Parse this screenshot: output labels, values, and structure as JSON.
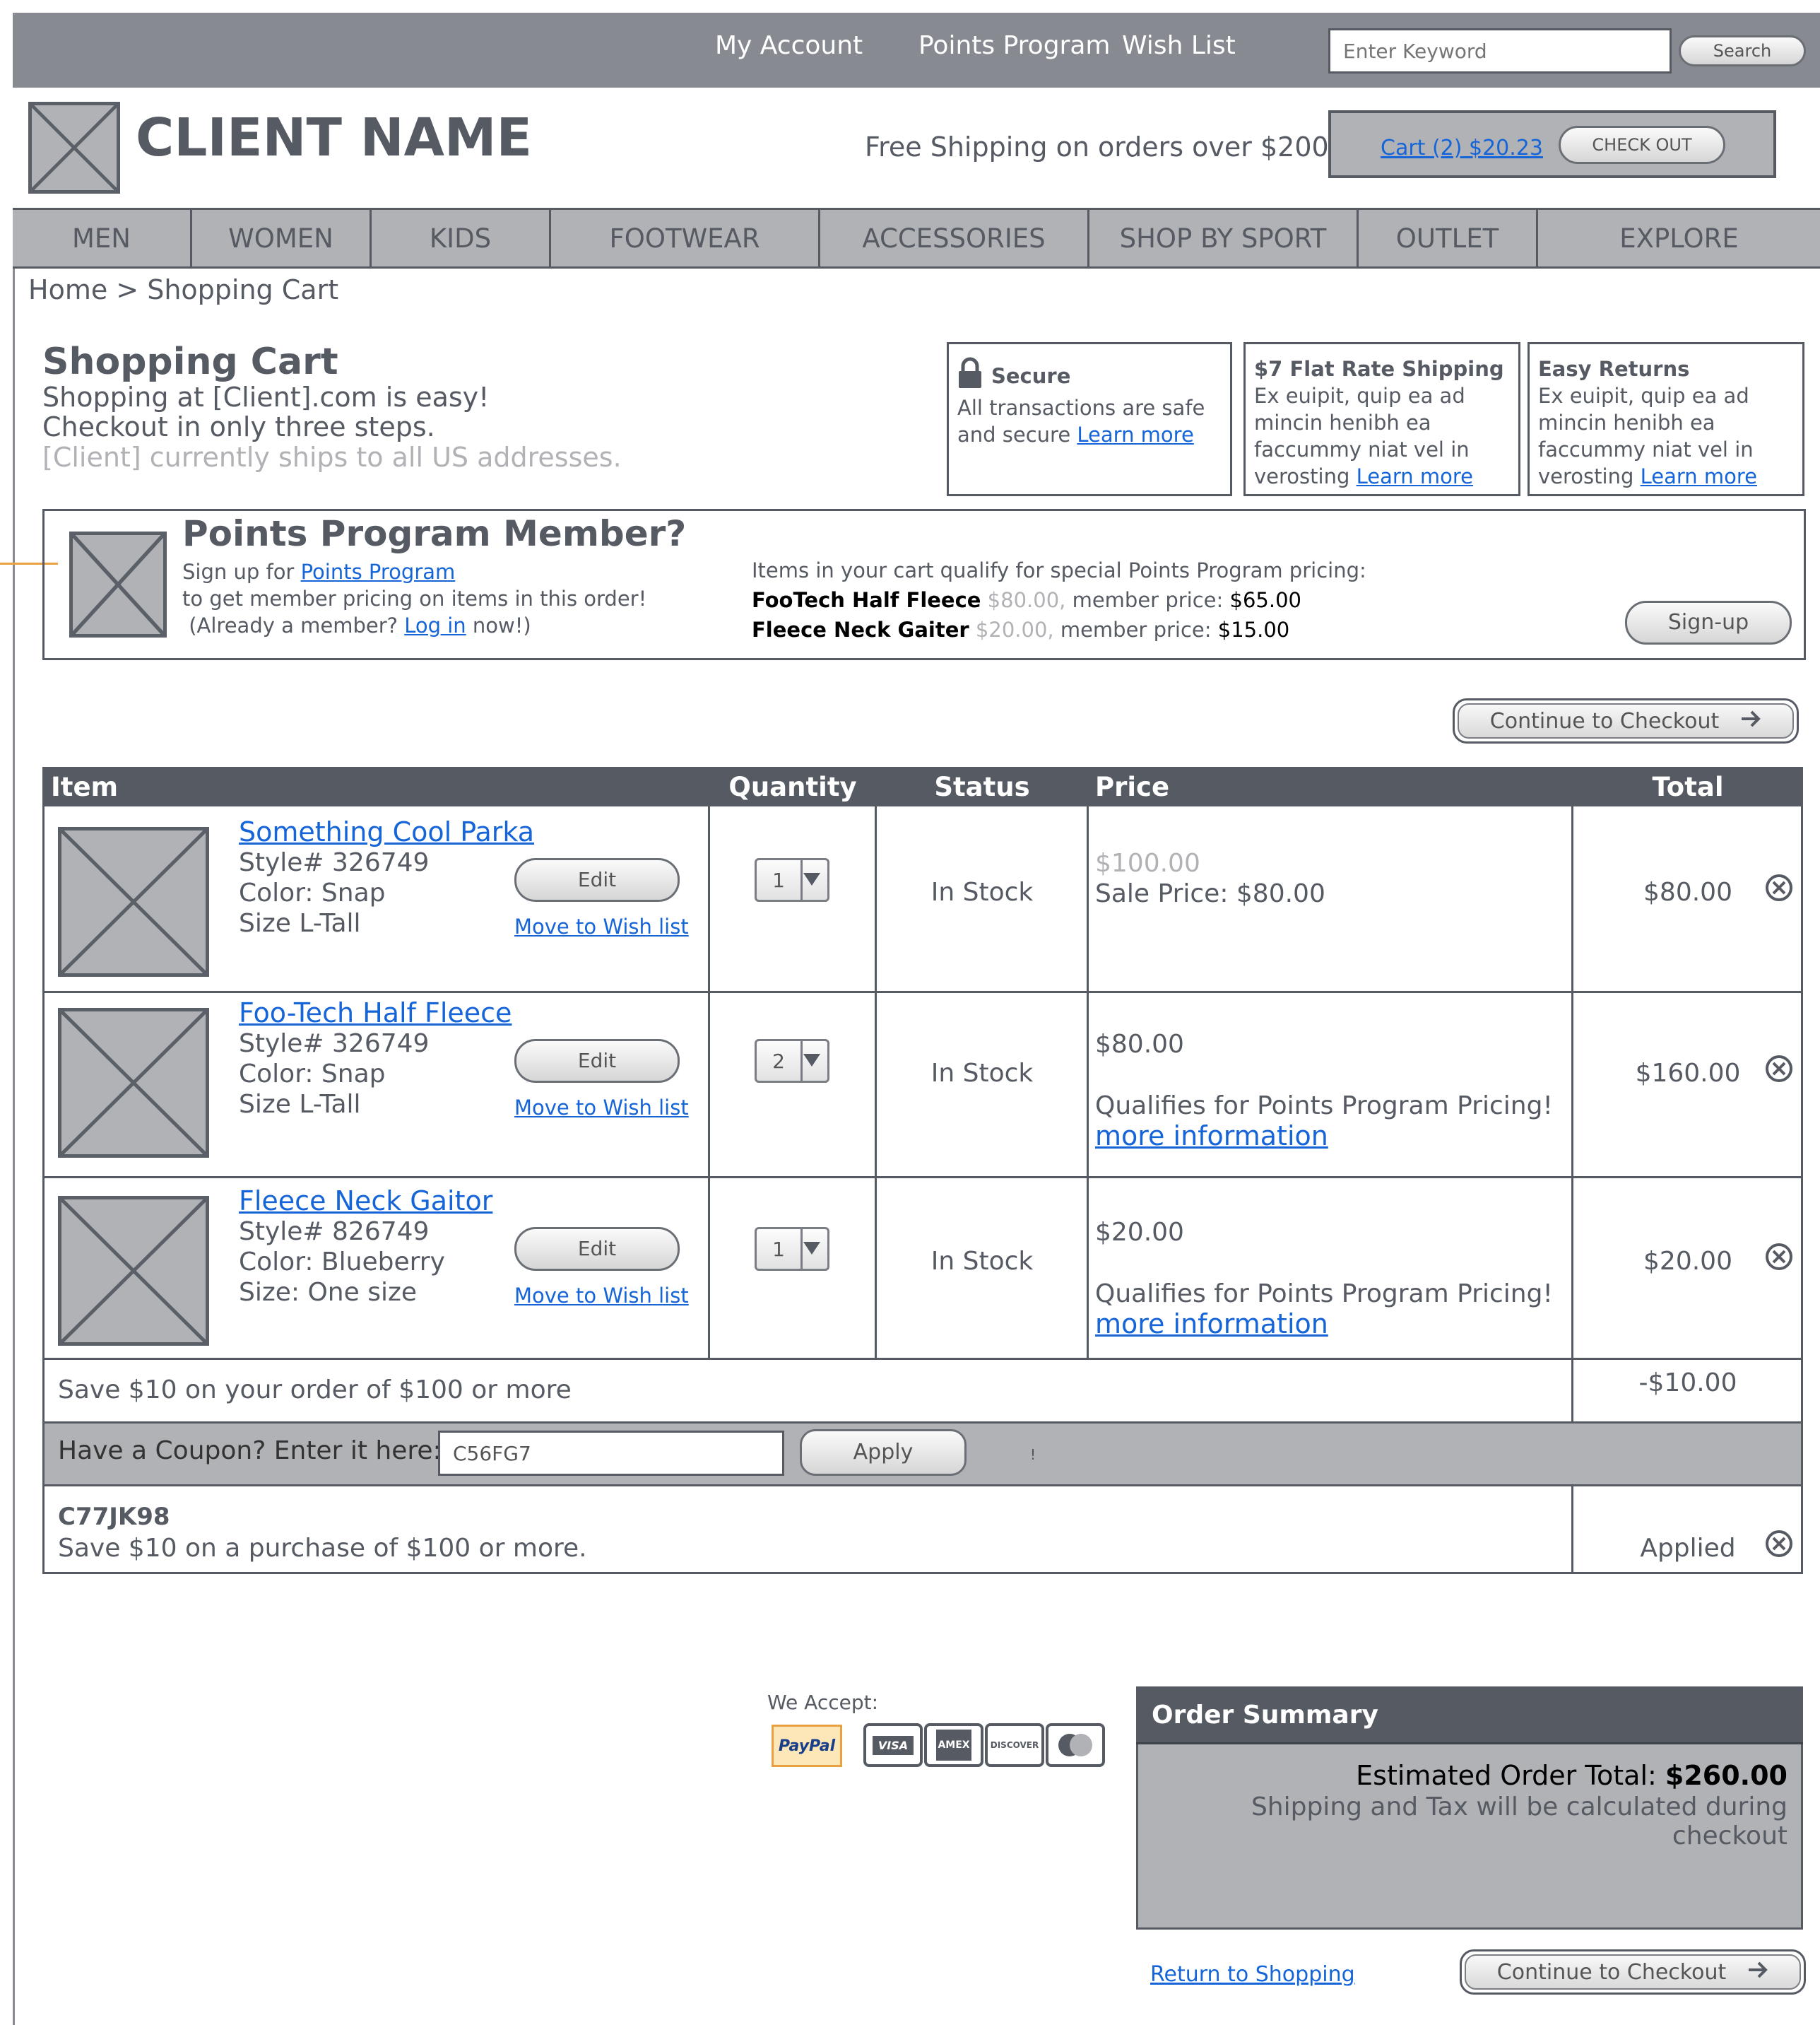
{
  "topbar": {
    "my_account": "My Account",
    "points_program": "Points Program",
    "wish_list": "Wish List",
    "search_placeholder": "Enter Keyword",
    "search_button": "Search"
  },
  "header": {
    "client_name": "CLIENT NAME",
    "free_shipping": "Free Shipping on orders over $200",
    "cart_link": "Cart (2) $20.23",
    "checkout_button": "CHECK OUT"
  },
  "nav": {
    "items": [
      "MEN",
      "WOMEN",
      "KIDS",
      "FOOTWEAR",
      "ACCESSORIES",
      "SHOP BY SPORT",
      "OUTLET",
      "EXPLORE"
    ]
  },
  "breadcrumb": "Home > Shopping Cart",
  "intro": {
    "title": "Shopping Cart",
    "line1": "Shopping at [Client].com is easy!",
    "line2": "Checkout in only three steps.",
    "line3": "[Client] currently ships to all US addresses."
  },
  "info_boxes": [
    {
      "title": "Secure",
      "text": "All transactions are safe and secure",
      "link": "Learn more"
    },
    {
      "title": "$7 Flat Rate Shipping",
      "text": "Ex euipit, quip ea ad mincin henibh ea faccummy niat vel in verosting",
      "link": "Learn more"
    },
    {
      "title": "Easy Returns",
      "text": "Ex euipit, quip ea ad mincin henibh ea faccummy niat vel in verosting",
      "link": "Learn more"
    }
  ],
  "points": {
    "title": "Points Program Member?",
    "signup_prefix": "Sign up for",
    "signup_link": "Points Program",
    "line2": "to get member pricing on items in this order!",
    "already_prefix": "(Already a member?",
    "login_link": "Log in",
    "already_suffix": "now!)",
    "qualify_text": "Items in your cart qualify for special Points Program pricing:",
    "items": [
      {
        "name": "FooTech Half Fleece",
        "old_price": "$80.00,",
        "member_label": "member price:",
        "member_price": "$65.00"
      },
      {
        "name": "Fleece Neck Gaiter",
        "old_price": "$20.00,",
        "member_label": "member price:",
        "member_price": "$15.00"
      }
    ],
    "signup_button": "Sign-up"
  },
  "continue_checkout": "Continue to Checkout",
  "table": {
    "headers": {
      "item": "Item",
      "quantity": "Quantity",
      "status": "Status",
      "price": "Price",
      "total": "Total"
    },
    "rows": [
      {
        "name": "Something Cool Parka",
        "style": "Style# 326749",
        "color": "Color: Snap",
        "size": "Size L-Tall",
        "edit": "Edit",
        "wish": "Move to Wish list",
        "qty": "1",
        "status": "In Stock",
        "price_old": "$100.00",
        "price_main": "Sale Price: $80.00",
        "points_note": "",
        "more_info": "",
        "total": "$80.00"
      },
      {
        "name": "Foo-Tech Half Fleece",
        "style": "Style# 326749",
        "color": "Color: Snap",
        "size": "Size L-Tall",
        "edit": "Edit",
        "wish": "Move to Wish list",
        "qty": "2",
        "status": "In Stock",
        "price_old": "",
        "price_main": "$80.00",
        "points_note": "Qualifies for Points Program Pricing!",
        "more_info": "more information",
        "total": "$160.00"
      },
      {
        "name": "Fleece Neck Gaitor",
        "style": "Style# 826749",
        "color": "Color: Blueberry",
        "size": "Size: One size",
        "edit": "Edit",
        "wish": "Move to Wish list",
        "qty": "1",
        "status": "In Stock",
        "price_old": "",
        "price_main": "$20.00",
        "points_note": "Qualifies for Points Program Pricing!",
        "more_info": "more information",
        "total": "$20.00"
      }
    ],
    "promo_text": "Save $10 on your order of $100 or more",
    "promo_amount": "-$10.00",
    "coupon_label": "Have a Coupon? Enter it here:",
    "coupon_value": "C56FG7",
    "apply_button": "Apply",
    "coupon_mark": "!",
    "applied_code": "C77JK98",
    "applied_desc": "Save $10 on a purchase of $100 or more.",
    "applied_status": "Applied"
  },
  "payment": {
    "label": "We Accept:",
    "cards": [
      "PayPal",
      "VISA",
      "AMEX",
      "DISCOVER",
      "mastercard-icon"
    ]
  },
  "summary": {
    "title": "Order Summary",
    "total_label": "Estimated Order Total:",
    "total_value": "$260.00",
    "note": "Shipping and Tax will be calculated during checkout"
  },
  "footer": {
    "return_link": "Return to Shopping",
    "continue_checkout": "Continue to Checkout"
  },
  "colors": {
    "dark": "#555a63",
    "mid": "#878a90",
    "light": "#b1b2b6",
    "link": "#1565d8"
  }
}
